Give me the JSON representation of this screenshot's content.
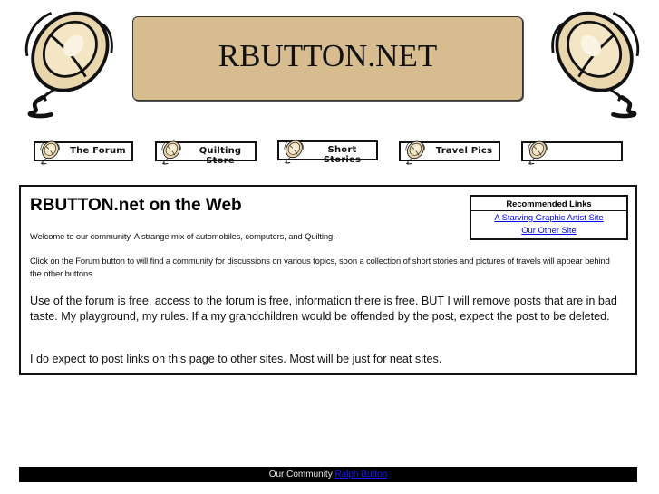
{
  "header": {
    "title": "RBUTTON.NET",
    "banner_color": "#d6bc8e",
    "left_icon": "computer-mouse-icon",
    "right_icon": "computer-mouse-icon"
  },
  "nav": {
    "items": [
      {
        "label": "The Forum",
        "icon": "computer-mouse-icon"
      },
      {
        "label": "Quilting Store",
        "icon": "computer-mouse-icon"
      },
      {
        "label": "Short Stories",
        "icon": "computer-mouse-icon"
      },
      {
        "label": "Travel Pics",
        "icon": "computer-mouse-icon"
      },
      {
        "label": "",
        "icon": "computer-mouse-icon"
      }
    ]
  },
  "main": {
    "heading": "RBUTTON.net on the Web",
    "welcome": "Welcome to our community. A strange mix of automobiles, computers, and Quilting.",
    "click_info": "Click on the Forum button to will find a community for discussions on various topics, soon a collection of short stories and pictures of travels will appear behind the other buttons.",
    "use_policy": "Use of the forum is free, access to the forum is free, information there is free. BUT I will remove posts that are in bad taste. My playground, my rules. If a my grandchildren would be offended by the post, expect the post to be deleted.",
    "links_note": "I do expect to post links on this page to other sites. Most will be just for neat sites."
  },
  "recommended": {
    "heading": "Recommended Links",
    "links": [
      {
        "label": "A Starving Graphic Artist Site"
      },
      {
        "label": "Our Other Site"
      }
    ]
  },
  "footer": {
    "text": "Our Community",
    "link_label": "Ralph Button"
  },
  "colors": {
    "link": "#0000ee",
    "footer_bg": "#000000"
  }
}
